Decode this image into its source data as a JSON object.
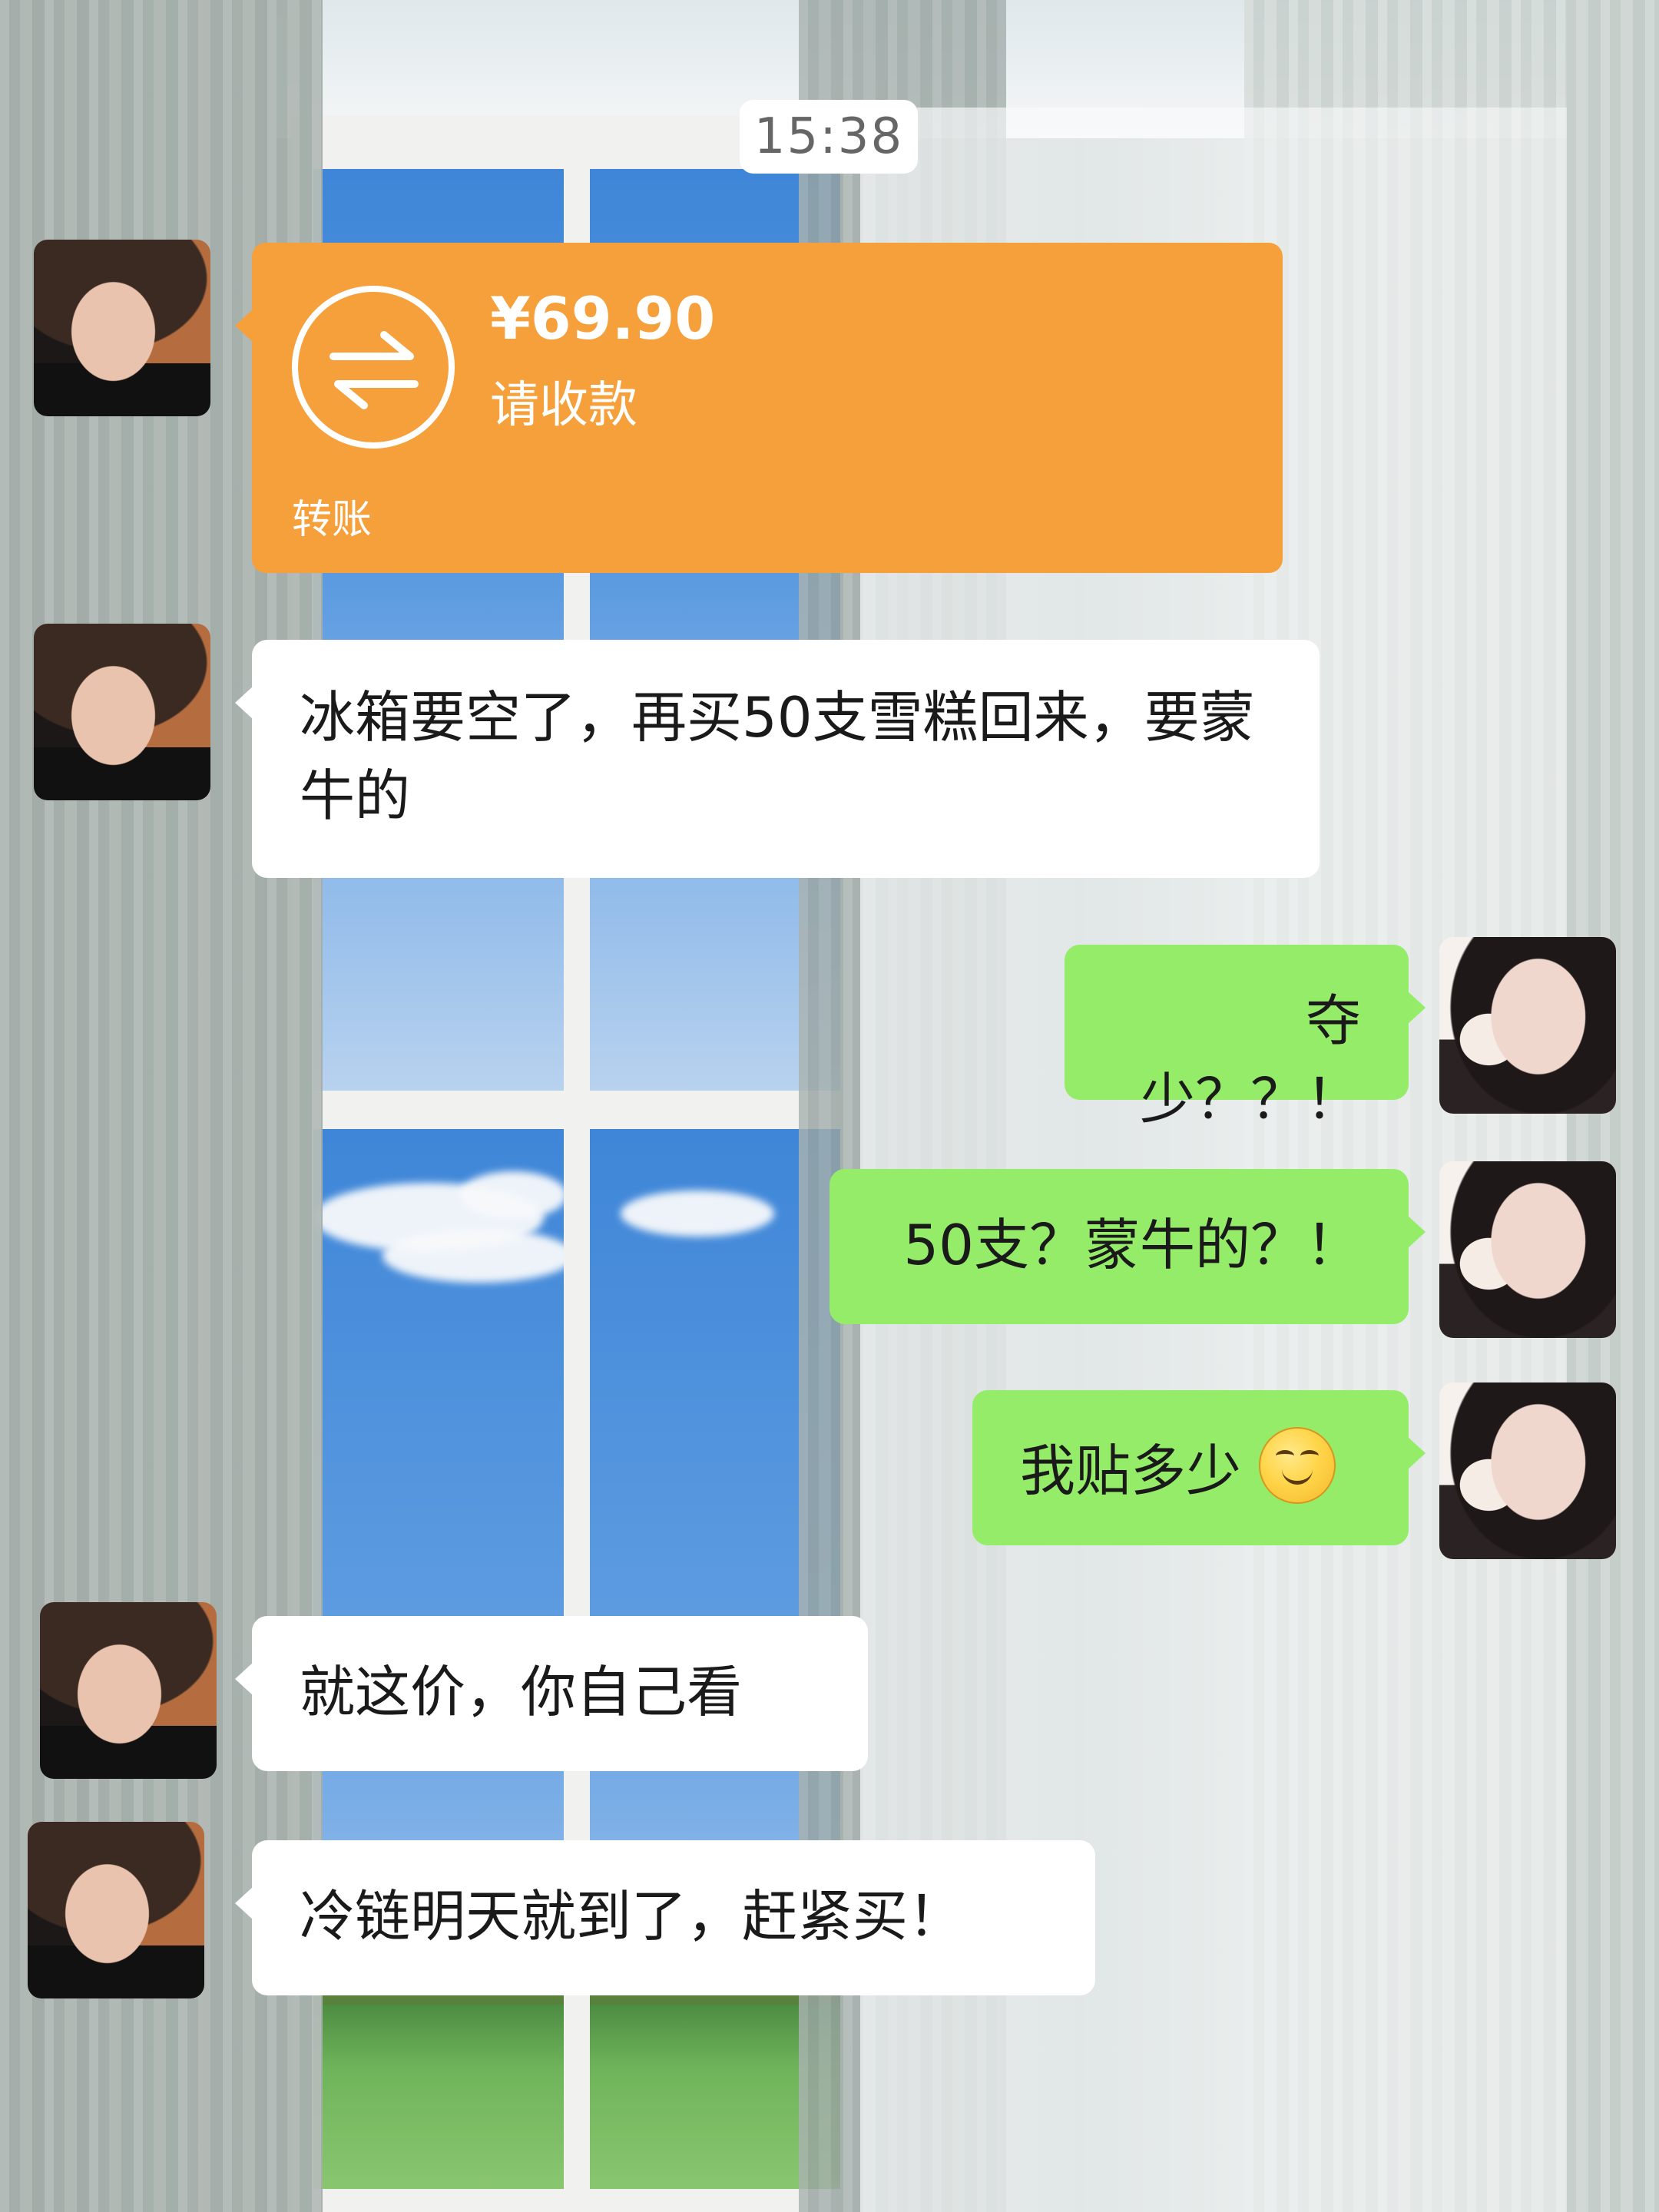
{
  "chat": {
    "timestamp": "15:38",
    "transfer": {
      "amount": "¥69.90",
      "note": "请收款",
      "footer": "转账"
    },
    "messages": [
      {
        "sender": "other",
        "text": "冰箱要空了，再买50支雪糕回来，要蒙牛的"
      },
      {
        "sender": "me",
        "text": "夺少？？！"
      },
      {
        "sender": "me",
        "text": "50支？蒙牛的？！"
      },
      {
        "sender": "me",
        "text": "我贴多少"
      },
      {
        "sender": "other",
        "text": "就这价，你自己看"
      },
      {
        "sender": "other",
        "text": "冷链明天就到了，赶紧买！"
      }
    ]
  },
  "emoji": {
    "name": "smirk-emoji"
  },
  "colors": {
    "transfer": "#f6a03c",
    "incoming_bubble": "#ffffff",
    "outgoing_bubble": "#95ec69"
  }
}
